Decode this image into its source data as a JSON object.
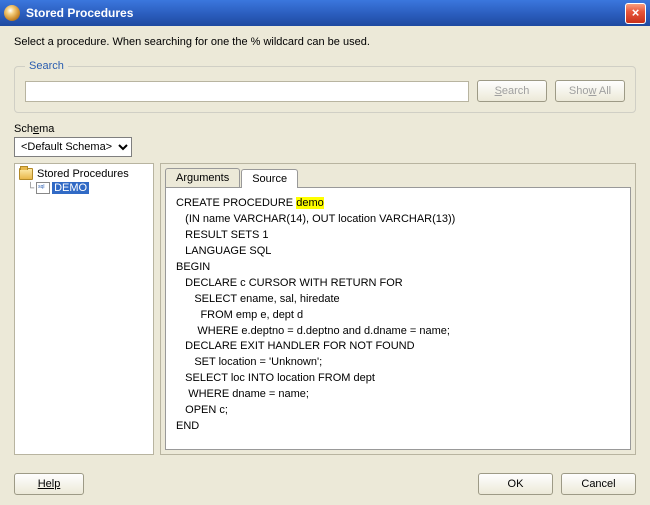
{
  "window": {
    "title": "Stored Procedures"
  },
  "instruction": "Select a procedure. When searching for one the % wildcard can be used.",
  "search": {
    "legend": "Search",
    "value": "",
    "placeholder": "",
    "search_btn": "Search",
    "showall_btn": "Show All"
  },
  "schema": {
    "label": "Schema",
    "selected": "<Default Schema>",
    "options": [
      "<Default Schema>"
    ]
  },
  "tree": {
    "root_label": "Stored Procedures",
    "items": [
      {
        "label": "DEMO",
        "selected": true
      }
    ]
  },
  "tabs": {
    "items": [
      {
        "label": "Arguments",
        "active": false
      },
      {
        "label": "Source",
        "active": true
      }
    ]
  },
  "source": {
    "lines": [
      "CREATE PROCEDURE ",
      "   (IN name VARCHAR(14), OUT location VARCHAR(13))",
      "   RESULT SETS 1",
      "   LANGUAGE SQL",
      "BEGIN",
      "   DECLARE c CURSOR WITH RETURN FOR",
      "      SELECT ename, sal, hiredate",
      "        FROM emp e, dept d",
      "       WHERE e.deptno = d.deptno and d.dname = name;",
      "   DECLARE EXIT HANDLER FOR NOT FOUND",
      "      SET location = 'Unknown';",
      "   SELECT loc INTO location FROM dept",
      "    WHERE dname = name;",
      "   OPEN c;",
      "END"
    ],
    "highlight": "demo"
  },
  "buttons": {
    "help": "Help",
    "ok": "OK",
    "cancel": "Cancel"
  }
}
